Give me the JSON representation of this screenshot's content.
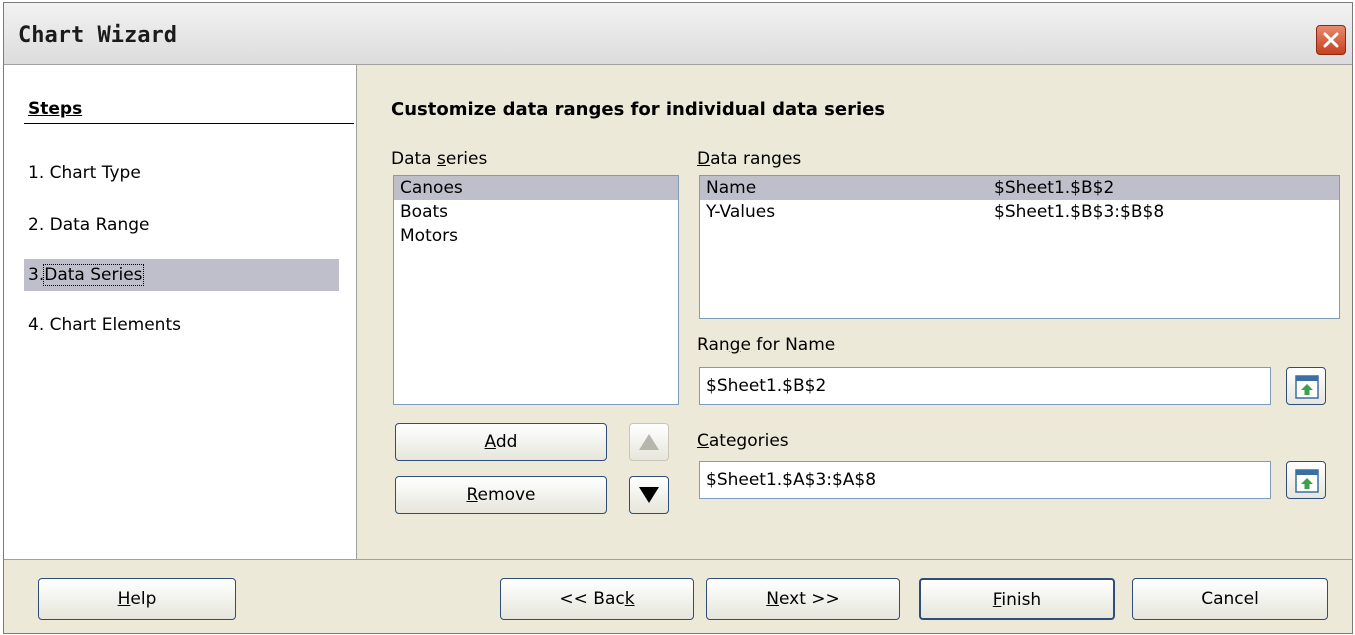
{
  "window": {
    "title": "Chart Wizard"
  },
  "steps": {
    "title": "Steps",
    "items": [
      {
        "label": "1. Chart Type"
      },
      {
        "label": "2. Data Range"
      },
      {
        "num": "3.",
        "label": "Data Series"
      },
      {
        "label": "4. Chart Elements"
      }
    ]
  },
  "content": {
    "heading": "Customize data ranges for individual data series",
    "data_series": {
      "label_pre": "Data ",
      "label_ul": "s",
      "label_post": "eries",
      "items": [
        "Canoes",
        "Boats",
        "Motors"
      ],
      "selected": "Canoes"
    },
    "data_ranges": {
      "label_ul": "D",
      "label_post": "ata ranges",
      "rows": [
        {
          "role": "Name",
          "range": "$Sheet1.$B$2"
        },
        {
          "role": "Y-Values",
          "range": "$Sheet1.$B$3:$B$8"
        }
      ]
    },
    "range_for_name": {
      "label_pre": "Ran",
      "label_ul": "g",
      "label_post": "e for Name",
      "value": "$Sheet1.$B$2"
    },
    "categories": {
      "label_ul": "C",
      "label_post": "ategories",
      "value": "$Sheet1.$A$3:$A$8"
    },
    "buttons": {
      "add_ul": "A",
      "add_post": "dd",
      "remove_ul": "R",
      "remove_post": "emove"
    },
    "icons": {
      "move_up": "triangle-up-icon",
      "move_down": "triangle-down-icon",
      "shrink": "shrink-range-icon"
    }
  },
  "footer": {
    "help_ul": "H",
    "help_post": "elp",
    "back_pre": "<< Bac",
    "back_ul": "k",
    "next_ul": "N",
    "next_post": "ext >>",
    "finish_ul": "F",
    "finish_post": "inish",
    "cancel": "Cancel"
  }
}
